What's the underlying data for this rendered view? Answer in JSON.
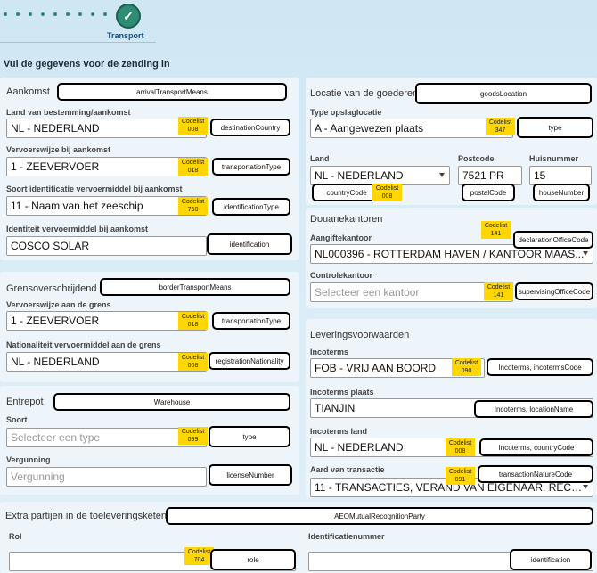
{
  "stepper": {
    "step_label": "Transport",
    "check_glyph": "✓"
  },
  "page_title": "Vul de gegevens voor de zending in",
  "codelist_word": "Codelist",
  "aankomst": {
    "title": "Aankomst",
    "tag": "arrivalTransportMeans",
    "dest_label": "Land van bestemming/aankomst",
    "dest_value": "NL - NEDERLAND",
    "dest_code": "008",
    "dest_tag": "destinationCountry",
    "mode_label": "Vervoerswijze bij aankomst",
    "mode_value": "1 - ZEEVERVOER",
    "mode_code": "018",
    "mode_tag": "transportationType",
    "idtype_label": "Soort identificatie vervoermiddel bij aankomst",
    "idtype_value": "11 - Naam van het zeeschip",
    "idtype_code": "750",
    "idtype_tag": "identificationType",
    "ident_label": "Identiteit vervoermiddel bij aankomst",
    "ident_value": "COSCO SOLAR",
    "ident_tag": "identification"
  },
  "grens": {
    "title": "Grensoverschrijdend",
    "tag": "borderTransportMeans",
    "mode_label": "Vervoerswijze aan de grens",
    "mode_value": "1 - ZEEVERVOER",
    "mode_code": "018",
    "mode_tag": "transportationType",
    "nat_label": "Nationaliteit vervoermiddel aan de grens",
    "nat_value": "NL - NEDERLAND",
    "nat_code": "008",
    "nat_tag": "registrationNationality"
  },
  "entrepot": {
    "title": "Entrepot",
    "tag": "Warehouse",
    "soort_label": "Soort",
    "soort_placeholder": "Selecteer een type",
    "soort_code": "099",
    "soort_tag": "type",
    "verg_label": "Vergunning",
    "verg_placeholder": "Vergunning",
    "verg_tag": "licenseNumber"
  },
  "locatie": {
    "title": "Locatie van de goederen",
    "tag": "goodsLocation",
    "type_label": "Type opslaglocatie",
    "type_value": "A - Aangewezen plaats",
    "type_code": "347",
    "type_tag": "type",
    "land_label": "Land",
    "land_value": "NL - NEDERLAND",
    "land_tag": "countryCode",
    "land_code": "008",
    "postcode_label": "Postcode",
    "postcode_value": "7521 PR",
    "postcode_tag": "postalCode",
    "huis_label": "Huisnummer",
    "huis_value": "15",
    "huis_tag": "houseNumber"
  },
  "douane": {
    "title": "Douanekantoren",
    "aangifte_label": "Aangiftekantoor",
    "aangifte_value": "NL000396 - ROTTERDAM HAVEN / KANTOOR MAAS...",
    "aangifte_code": "141",
    "aangifte_tag": "declarationOfficeCode",
    "controle_label": "Controlekantoor",
    "controle_placeholder": "Selecteer een kantoor",
    "controle_code": "141",
    "controle_tag": "supervisingOfficeCode"
  },
  "levering": {
    "title": "Leveringsvoorwaarden",
    "inco_label": "Incoterms",
    "inco_value": "FOB - VRIJ AAN BOORD",
    "inco_code": "090",
    "inco_tag": "Incoterms, incotermsCode",
    "plaats_label": "Incoterms plaats",
    "plaats_value": "TIANJIN",
    "plaats_tag": "Incoterms, locationName",
    "land_label": "Incoterms land",
    "land_value": "NL - NEDERLAND",
    "land_code": "008",
    "land_tag": "Incoterms, countryCode",
    "aard_label": "Aard van transactie",
    "aard_value": "11 - TRANSACTIES, VERAND VAN EIGENAAR. RECHT...",
    "aard_code": "091",
    "aard_tag": "transactionNatureCode"
  },
  "extra": {
    "title": "Extra partijen in de toeleveringsketen",
    "tag": "AEOMutualRecognitionParty",
    "rol_label": "Rol",
    "rol_code": "704",
    "rol_tag": "role",
    "id_label": "Identificatienummer",
    "id_tag": "identification"
  }
}
